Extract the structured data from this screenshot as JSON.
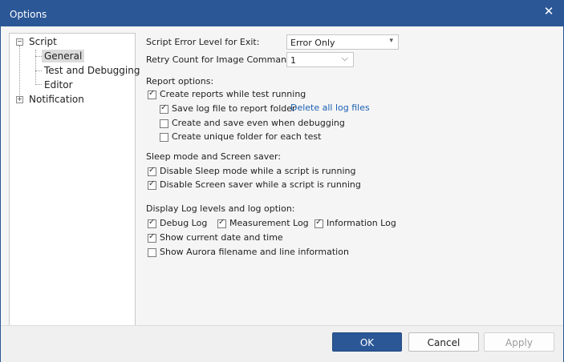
{
  "window": {
    "title": "Options",
    "close_glyph": "✕"
  },
  "tree": {
    "items": [
      {
        "label": "Script",
        "toggle": "−"
      },
      {
        "label": "General"
      },
      {
        "label": "Test and Debugging"
      },
      {
        "label": "Editor"
      },
      {
        "label": "Notification",
        "toggle": "+"
      }
    ]
  },
  "general": {
    "error_level_label": "Script Error Level for Exit:",
    "error_level_value": "Error Only",
    "retry_label": "Retry Count for Image Command:",
    "retry_value": "1",
    "report_section": "Report options:",
    "create_reports": "Create reports while test running",
    "save_log": "Save log file to report folder",
    "delete_logs": "Delete all log files",
    "create_when_debugging": "Create and save even when debugging",
    "unique_folder": "Create unique folder for each test",
    "sleep_section": "Sleep mode and Screen saver:",
    "disable_sleep": "Disable Sleep mode while a script is running",
    "disable_screensaver": "Disable Screen saver while a script is running",
    "log_section": "Display Log levels and log option:",
    "debug_log": "Debug Log",
    "measurement_log": "Measurement Log",
    "information_log": "Information Log",
    "show_date": "Show current date and time",
    "show_filename": "Show Aurora filename and line information",
    "check_glyph": "✓",
    "dropdown_glyph": "▾",
    "chevron_glyph": "⌵"
  },
  "checkbox_states": {
    "create_reports": true,
    "save_log": true,
    "create_when_debugging": false,
    "unique_folder": false,
    "disable_sleep": true,
    "disable_screensaver": true,
    "debug_log": true,
    "measurement_log": true,
    "information_log": true,
    "show_date": true,
    "show_filename": false
  },
  "buttons": {
    "ok": "OK",
    "cancel": "Cancel",
    "apply": "Apply"
  },
  "colors": {
    "accent": "#2b5797",
    "link": "#1a5fb4"
  }
}
